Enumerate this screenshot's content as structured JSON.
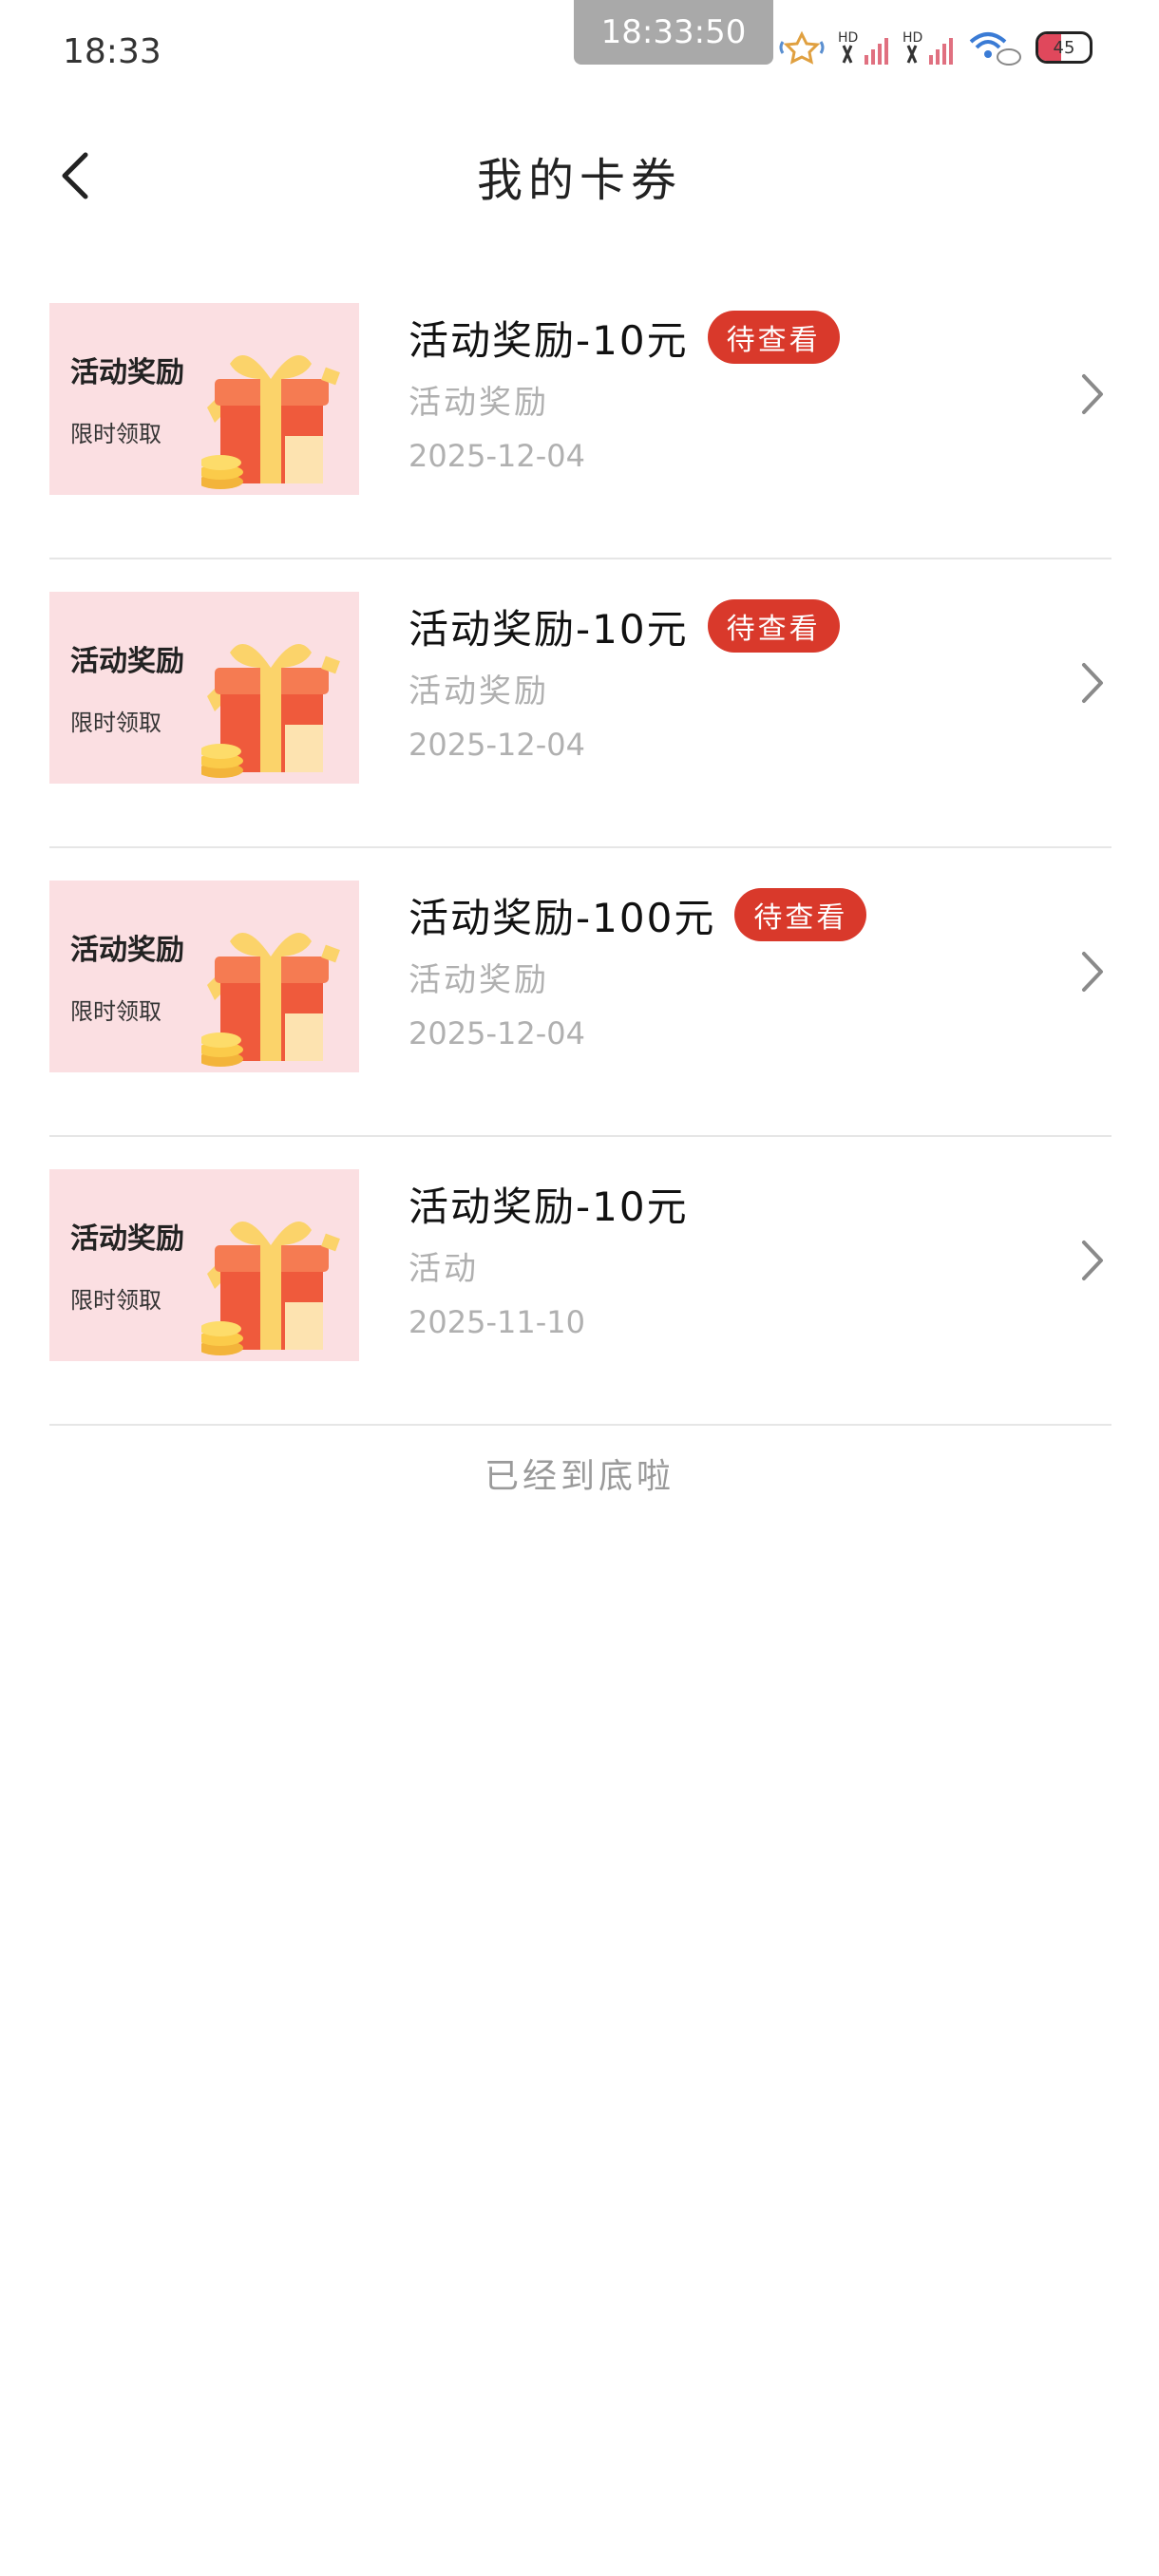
{
  "status_bar": {
    "time": "18:33",
    "clock": "18:33:50",
    "battery_level": "45"
  },
  "header": {
    "title": "我的卡券"
  },
  "thumbnail": {
    "title": "活动奖励",
    "subtitle": "限时领取"
  },
  "coupons": [
    {
      "title": "活动奖励-10元",
      "badge": "待查看",
      "description": "活动奖励",
      "date": "2025-12-04"
    },
    {
      "title": "活动奖励-10元",
      "badge": "待查看",
      "description": "活动奖励",
      "date": "2025-12-04"
    },
    {
      "title": "活动奖励-100元",
      "badge": "待查看",
      "description": "活动奖励",
      "date": "2025-12-04"
    },
    {
      "title": "活动奖励-10元",
      "badge": "",
      "description": "活动",
      "date": "2025-11-10"
    }
  ],
  "footer": {
    "end_text": "已经到底啦"
  }
}
